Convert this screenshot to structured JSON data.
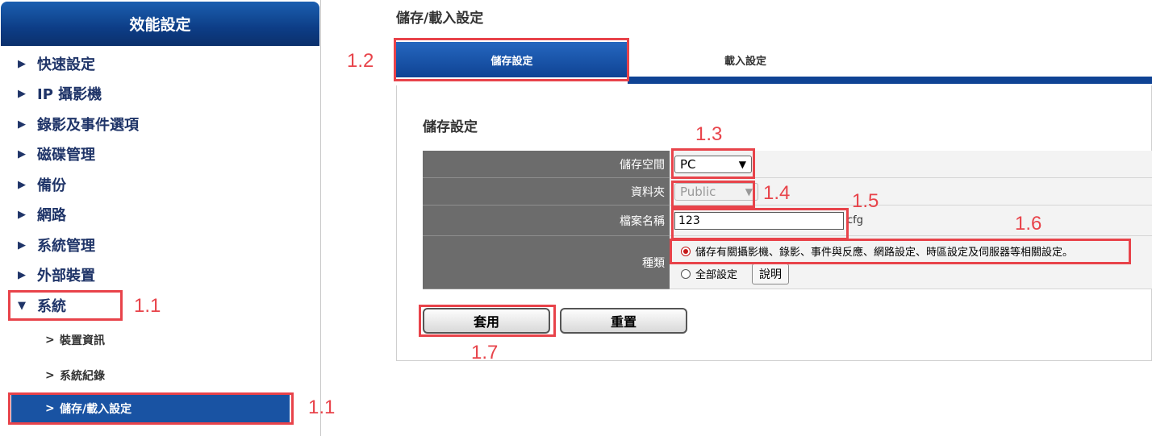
{
  "sidebar": {
    "title": "效能設定",
    "items": [
      {
        "label": "快速設定",
        "arrow": "▶"
      },
      {
        "label": "IP 攝影機",
        "arrow": "▶"
      },
      {
        "label": "錄影及事件選項",
        "arrow": "▶"
      },
      {
        "label": "磁碟管理",
        "arrow": "▶"
      },
      {
        "label": "備份",
        "arrow": "▶"
      },
      {
        "label": "網路",
        "arrow": "▶"
      },
      {
        "label": "系統管理",
        "arrow": "▶"
      },
      {
        "label": "外部裝置",
        "arrow": "▶"
      },
      {
        "label": "系統",
        "arrow": "▼"
      }
    ],
    "subitems": [
      {
        "label": "裝置資訊",
        "prefix": ">"
      },
      {
        "label": "系統紀錄",
        "prefix": ">"
      },
      {
        "label": "儲存/載入設定",
        "prefix": ">"
      }
    ]
  },
  "main": {
    "page_title": "儲存/載入設定",
    "tabs": [
      {
        "label": "儲存設定",
        "active": true
      },
      {
        "label": "載入設定",
        "active": false
      }
    ],
    "section_title": "儲存設定",
    "form": {
      "storage_label": "儲存空間",
      "storage_value": "PC",
      "folder_label": "資料夾",
      "folder_value": "Public",
      "filename_label": "檔案名稱",
      "filename_value": "123",
      "filename_ext": "cfg",
      "type_label": "種類",
      "type_option1": "儲存有關攝影機、錄影、事件與反應、網路設定、時區設定及伺服器等相關設定。",
      "type_option2": "全部設定",
      "explain_button": "說明"
    },
    "apply_button": "套用",
    "reset_button": "重置"
  },
  "annotations": {
    "a1_1": "1.1",
    "a1_1b": "1.1",
    "a1_2": "1.2",
    "a1_3": "1.3",
    "a1_4": "1.4",
    "a1_5": "1.5",
    "a1_6": "1.6",
    "a1_7": "1.7",
    "color": "#e8434a"
  }
}
